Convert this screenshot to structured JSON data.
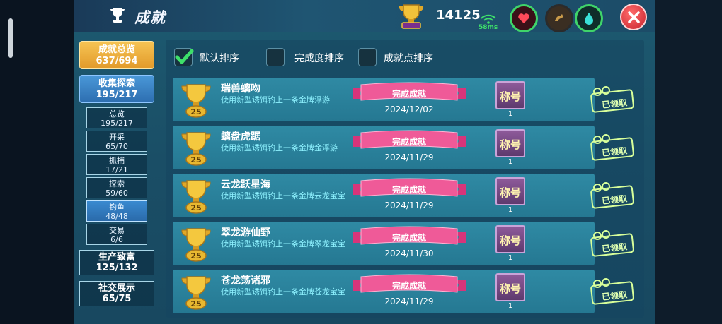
{
  "header": {
    "title": "成就",
    "score": "14125",
    "ping": "58ms"
  },
  "sidebar": {
    "summary": {
      "label": "成就总览",
      "count": "637/694"
    },
    "collect": {
      "label": "收集探索",
      "count": "195/217"
    },
    "sub_items": [
      {
        "label": "总览",
        "count": "195/217",
        "active": false
      },
      {
        "label": "开采",
        "count": "65/70",
        "active": false
      },
      {
        "label": "抓捕",
        "count": "17/21",
        "active": false
      },
      {
        "label": "探索",
        "count": "59/60",
        "active": false
      },
      {
        "label": "钓鱼",
        "count": "48/48",
        "active": true
      },
      {
        "label": "交易",
        "count": "6/6",
        "active": false
      }
    ],
    "production": {
      "label": "生产致富",
      "count": "125/132"
    },
    "social": {
      "label": "社交展示",
      "count": "65/75"
    }
  },
  "sort": {
    "default": {
      "label": "默认排序",
      "checked": true
    },
    "completion": {
      "label": "完成度排序",
      "checked": false
    },
    "points": {
      "label": "成就点排序",
      "checked": false
    }
  },
  "rows": [
    {
      "points": "25",
      "name": "瑞兽螭吻",
      "desc": "使用新型诱饵钓上一条金牌浮游",
      "status": "完成成就",
      "date": "2024/12/02",
      "badge": "称号",
      "badge_count": "1",
      "claimed": "已领取"
    },
    {
      "points": "25",
      "name": "螭盘虎踞",
      "desc": "使用新型诱饵钓上一条金牌金浮游",
      "status": "完成成就",
      "date": "2024/11/29",
      "badge": "称号",
      "badge_count": "1",
      "claimed": "已领取"
    },
    {
      "points": "25",
      "name": "云龙跃星海",
      "desc": "使用新型诱饵钓上一条金牌云龙宝宝",
      "status": "完成成就",
      "date": "2024/11/29",
      "badge": "称号",
      "badge_count": "1",
      "claimed": "已领取"
    },
    {
      "points": "25",
      "name": "翠龙游仙野",
      "desc": "使用新型诱饵钓上一条金牌翠龙宝宝",
      "status": "完成成就",
      "date": "2024/11/30",
      "badge": "称号",
      "badge_count": "1",
      "claimed": "已领取"
    },
    {
      "points": "25",
      "name": "苍龙荡诸邪",
      "desc": "使用新型诱饵钓上一条金牌苍龙宝宝",
      "status": "完成成就",
      "date": "2024/11/29",
      "badge": "称号",
      "badge_count": "1",
      "claimed": "已领取"
    }
  ]
}
